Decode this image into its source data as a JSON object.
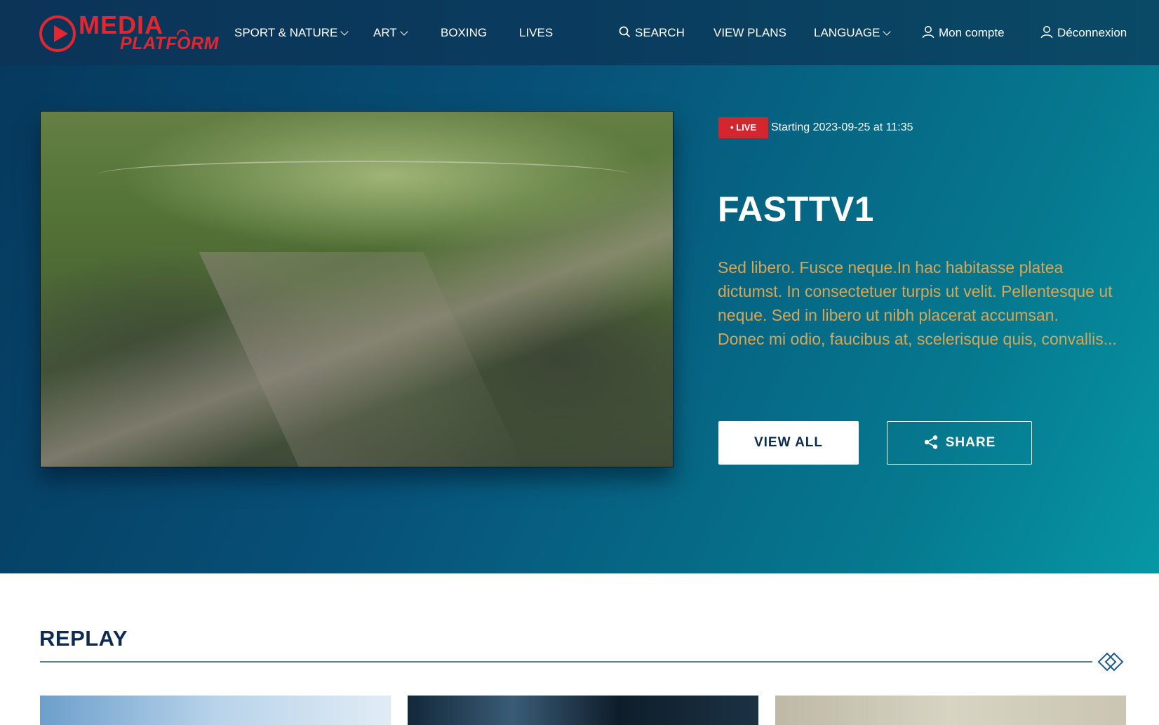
{
  "header": {
    "logo_line1": "MEDIA",
    "logo_line2": "PLATFORM",
    "nav": {
      "sport_nature": "SPORT & NATURE",
      "art": "ART",
      "boxing": "BOXING",
      "lives": "LIVES",
      "search": "SEARCH",
      "view_plans": "VIEW PLANS",
      "language": "LANGUAGE",
      "account": "Mon compte",
      "logout": "Déconnexion"
    }
  },
  "hero": {
    "badge": "• LIVE",
    "starting": "Starting 2023-09-25 at 11:35",
    "title": "FASTTV1",
    "description_1": "Sed libero. Fusce neque.In hac habitasse platea dictumst. In consectetuer turpis ut velit. Pellentesque ut neque. Sed in libero ut nibh placerat accumsan.",
    "description_2": "Donec mi odio, faucibus at, scelerisque quis, convallis...",
    "view_all": "VIEW ALL",
    "share": "SHARE"
  },
  "replay": {
    "title": "REPLAY"
  },
  "colors": {
    "brand_red": "#e3262f",
    "header_bg": "#0b3457",
    "description_gold": "#d8a553",
    "replay_navy": "#0c2a52"
  },
  "icons": {
    "search": "search-icon",
    "user": "user-icon",
    "share": "share-icon",
    "chevron": "chevron-down-icon",
    "arrow": "double-chevron-right-icon"
  }
}
